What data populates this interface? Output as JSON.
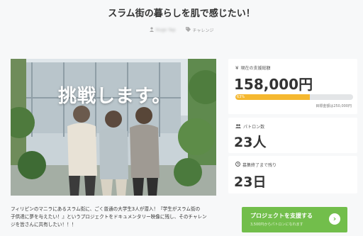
{
  "project": {
    "title": "スラム街の暮らしを肌で感じたい！",
    "owner": "Hugo Yap",
    "category": "チャレンジ",
    "hero_caption": "挑戦します。",
    "description_line1": "フィリピンのマニラにあるスラム街に、ごく普通の大学生3人が潜入！『学生がスラム街の",
    "description_line2": "子供達に夢を与えたい！』というプロジェクトをドキュメンタリー映像に残し、そのチャレン",
    "description_line3": "ジを皆さんに共有したい！！！"
  },
  "funding": {
    "label": "現在の支援総額",
    "amount": "158,000円",
    "percent_text": "63%",
    "percent_value": 0.63,
    "goal": "目標金額は250,000円"
  },
  "patrons": {
    "label": "パトロン数",
    "count": "23人"
  },
  "remaining": {
    "label": "募集終了まで残り",
    "days": "23日"
  },
  "cta": {
    "label": "プロジェクトを支援する",
    "sub": "3,500円からパトロンになれます"
  },
  "icons": {
    "owner": "user-icon",
    "category": "tag-icon",
    "funding": "yen-icon",
    "patrons": "people-icon",
    "remaining": "clock-icon",
    "cta": "chevron-right-icon"
  },
  "colors": {
    "accent_green": "#72be4b",
    "progress_orange": "#f5b830"
  }
}
